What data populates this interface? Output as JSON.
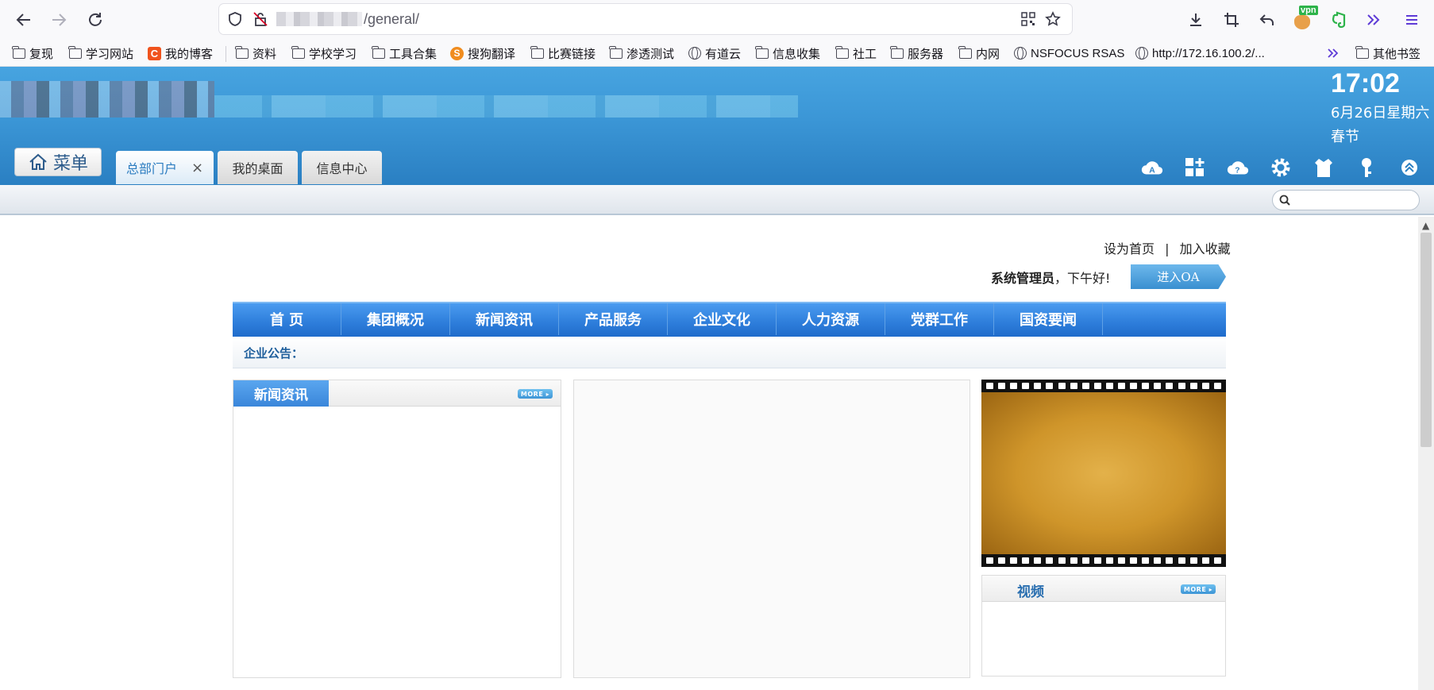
{
  "browser": {
    "url_suffix": "/general/",
    "bookmarks": [
      {
        "label": "复现",
        "icon": "folder-icon"
      },
      {
        "label": "学习网站",
        "icon": "folder-icon"
      },
      {
        "label": "我的博客",
        "icon": "csdn-icon"
      },
      {
        "label": "资料",
        "icon": "folder-icon"
      },
      {
        "label": "学校学习",
        "icon": "folder-icon"
      },
      {
        "label": "工具合集",
        "icon": "folder-icon"
      },
      {
        "label": "搜狗翻译",
        "icon": "sogou-icon"
      },
      {
        "label": "比赛链接",
        "icon": "folder-icon"
      },
      {
        "label": "渗透测试",
        "icon": "folder-icon"
      },
      {
        "label": "有道云",
        "icon": "globe-icon"
      },
      {
        "label": "信息收集",
        "icon": "folder-icon"
      },
      {
        "label": "社工",
        "icon": "folder-icon"
      },
      {
        "label": "服务器",
        "icon": "folder-icon"
      },
      {
        "label": "内网",
        "icon": "folder-icon"
      },
      {
        "label": "NSFOCUS RSAS",
        "icon": "globe-icon"
      },
      {
        "label": "http://172.16.100.2/...",
        "icon": "globe-icon"
      },
      {
        "label": "其他书签",
        "icon": "folder-icon"
      }
    ],
    "vpn_badge": "vpn"
  },
  "header": {
    "time": "17:02",
    "date": "6月26日星期六",
    "festival": "春节",
    "menu_label": "菜单",
    "tabs": [
      {
        "label": "总部门户",
        "active": true,
        "closable": true
      },
      {
        "label": "我的桌面",
        "active": false,
        "closable": false
      },
      {
        "label": "信息中心",
        "active": false,
        "closable": false
      }
    ],
    "tab_close": "×",
    "icons": [
      "cloud-a-icon",
      "add-apps-icon",
      "help-cloud-icon",
      "settings-gear-icon",
      "shirt-skin-icon",
      "key-icon",
      "collapse-icon"
    ]
  },
  "portal": {
    "set_home": "设为首页",
    "separator": "|",
    "add_favorite": "加入收藏",
    "user_name": "系统管理员",
    "greeting": "，下午好!",
    "enter_oa": "进入OA",
    "nav": [
      "首 页",
      "集团概况",
      "新闻资讯",
      "产品服务",
      "企业文化",
      "人力资源",
      "党群工作",
      "国资要闻"
    ],
    "notice_label": "企业公告：",
    "news_title": "新闻资讯",
    "video_title": "视频",
    "more_label": "MORE ▸"
  }
}
